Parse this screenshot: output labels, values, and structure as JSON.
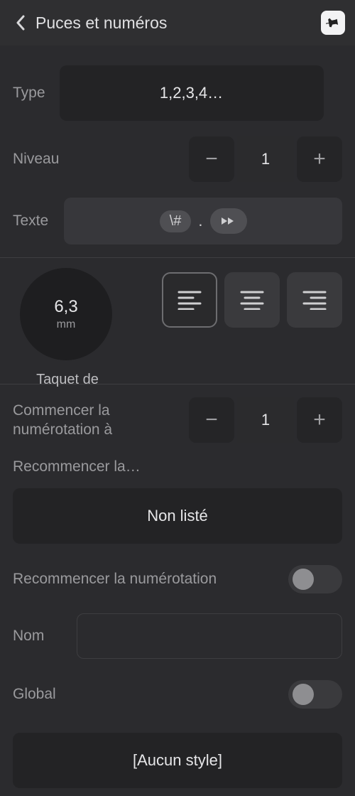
{
  "header": {
    "title": "Puces et numéros"
  },
  "type": {
    "label": "Type",
    "value": "1,2,3,4…"
  },
  "niveau": {
    "label": "Niveau",
    "value": "1"
  },
  "texte": {
    "label": "Texte",
    "token": "\\#",
    "sep": "."
  },
  "tab": {
    "value": "6,3",
    "unit": "mm",
    "caption": "Taquet de"
  },
  "start": {
    "label": "Commencer la numérotation à",
    "value": "1"
  },
  "restart_label": "Recommencer la…",
  "nonliste": "Non listé",
  "restart_toggle_label": "Recommencer la numérotation",
  "nom": {
    "label": "Nom",
    "value": ""
  },
  "global": {
    "label": "Global"
  },
  "style_btn": "[Aucun style]"
}
